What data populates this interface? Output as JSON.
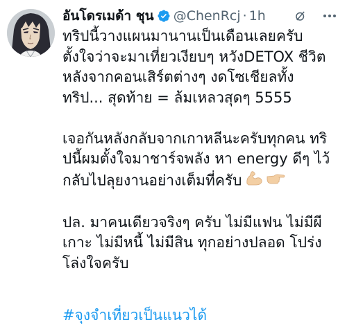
{
  "author": {
    "display_name": "อันโดรเมด้า ชุน",
    "handle": "@ChenRcj",
    "separator": "·",
    "time_ago": "1h",
    "verified": true
  },
  "tweet": {
    "paragraphs": [
      [
        "ทริปนี้วางแผนมานานเป็นเดือนเลยครับ",
        "ตั้งใจว่าจะมาเที่ยวเงียบๆ หวังDETOX ชีวิต",
        "หลังจากคอนเสิร์ตต่างๆ งดโซเชียลทั้ง",
        "ทริป... สุดท้าย = ล้มเหลวสุดๆ 5555"
      ],
      [
        "เจอกันหลังกลับจากเกาหลีนะครับทุกคน ทริ",
        "ปนี้ผมตั้งใจมาชาร์จพลัง หา energy ดีๆ ไว้",
        "กลับไปลุยงานอย่างเต็มที่ครับ"
      ],
      [
        "ปล. มาคนเดียวจริงๆ ครับ ไม่มีแฟน ไม่มีผี",
        "เกาะ ไม่มีหนี้ ไม่มีสิน ทุกอย่างปลอด โปร่ง",
        "โล่งใจครับ"
      ]
    ],
    "emojis": [
      "flexed-biceps-light-skin",
      "backhand-index-pointing-right-light-skin"
    ],
    "hashtag": "#จุงจำเที่ยวเป็นแนวได้"
  },
  "icons": {
    "verified": "verified-badge-icon",
    "grok": "grok-icon",
    "more": "more-options-icon",
    "avatar": "profile-avatar"
  },
  "colors": {
    "text": "#0f1419",
    "secondary": "#536471",
    "link": "#1d9bf0",
    "skin": "#f3cfa4"
  }
}
